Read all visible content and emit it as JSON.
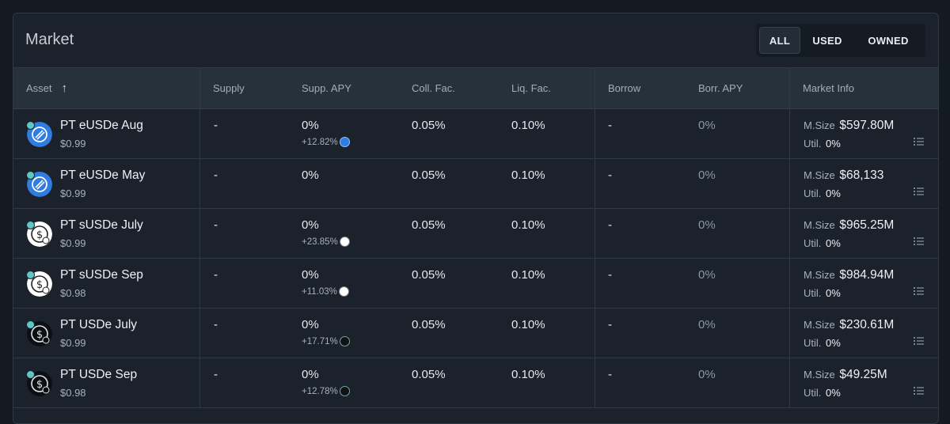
{
  "title": "Market",
  "filters": [
    {
      "label": "ALL",
      "active": true
    },
    {
      "label": "USED",
      "active": false
    },
    {
      "label": "OWNED",
      "active": false
    }
  ],
  "columns": {
    "asset": "Asset",
    "supply": "Supply",
    "supp_apy": "Supp. APY",
    "coll_fac": "Coll. Fac.",
    "liq_fac": "Liq. Fac.",
    "borrow": "Borrow",
    "borr_apy": "Borr. APY",
    "market_info": "Market Info"
  },
  "sort_arrow": "↑",
  "labels": {
    "msize": "M.Size",
    "util": "Util."
  },
  "rows": [
    {
      "name": "PT eUSDe Aug",
      "price": "$0.99",
      "icon": "eusde-icon",
      "supply": "-",
      "supp_apy": "0%",
      "supp_apy_bonus": "+12.82%",
      "coll_fac": "0.05%",
      "liq_fac": "0.10%",
      "borrow": "-",
      "borr_apy": "0%",
      "msize": "$597.80M",
      "util": "0%"
    },
    {
      "name": "PT eUSDe May",
      "price": "$0.99",
      "icon": "eusde-icon",
      "supply": "-",
      "supp_apy": "0%",
      "supp_apy_bonus": "",
      "coll_fac": "0.05%",
      "liq_fac": "0.10%",
      "borrow": "-",
      "borr_apy": "0%",
      "msize": "$68,133",
      "util": "0%"
    },
    {
      "name": "PT sUSDe July",
      "price": "$0.99",
      "icon": "susde-icon",
      "supply": "-",
      "supp_apy": "0%",
      "supp_apy_bonus": "+23.85%",
      "coll_fac": "0.05%",
      "liq_fac": "0.10%",
      "borrow": "-",
      "borr_apy": "0%",
      "msize": "$965.25M",
      "util": "0%"
    },
    {
      "name": "PT sUSDe Sep",
      "price": "$0.98",
      "icon": "susde-icon",
      "supply": "-",
      "supp_apy": "0%",
      "supp_apy_bonus": "+11.03%",
      "coll_fac": "0.05%",
      "liq_fac": "0.10%",
      "borrow": "-",
      "borr_apy": "0%",
      "msize": "$984.94M",
      "util": "0%"
    },
    {
      "name": "PT USDe July",
      "price": "$0.99",
      "icon": "usde-icon",
      "supply": "-",
      "supp_apy": "0%",
      "supp_apy_bonus": "+17.71%",
      "coll_fac": "0.05%",
      "liq_fac": "0.10%",
      "borrow": "-",
      "borr_apy": "0%",
      "msize": "$230.61M",
      "util": "0%"
    },
    {
      "name": "PT USDe Sep",
      "price": "$0.98",
      "icon": "usde-icon",
      "supply": "-",
      "supp_apy": "0%",
      "supp_apy_bonus": "+12.78%",
      "coll_fac": "0.05%",
      "liq_fac": "0.10%",
      "borrow": "-",
      "borr_apy": "0%",
      "msize": "$49.25M",
      "util": "0%"
    }
  ]
}
